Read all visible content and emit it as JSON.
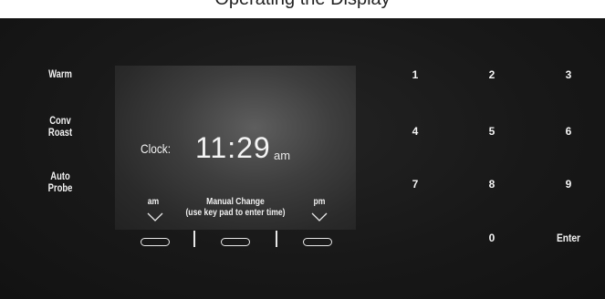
{
  "header": {
    "caption": "Operating the Display"
  },
  "side_buttons": [
    {
      "line1": "Warm",
      "line2": ""
    },
    {
      "line1": "Conv",
      "line2": "Roast"
    },
    {
      "line1": "Auto",
      "line2": "Probe"
    }
  ],
  "display": {
    "clock_label": "Clock:",
    "time": "11:29",
    "time_suffix": "am",
    "left_soft_label": "am",
    "center_soft_label_line1": "Manual Change",
    "center_soft_label_line2": "(use key pad to enter time)",
    "right_soft_label": "pm"
  },
  "keypad": {
    "keys": [
      "1",
      "2",
      "3",
      "4",
      "5",
      "6",
      "7",
      "8",
      "9",
      "0",
      "Enter"
    ]
  },
  "colors": {
    "panel_bg": "#141414",
    "display_bg": "#3e3e3e",
    "text": "#f2f2f2"
  }
}
